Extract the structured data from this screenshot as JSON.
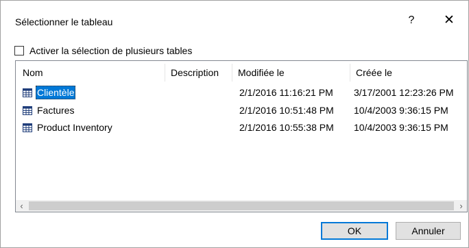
{
  "dialog": {
    "title": "Sélectionner le tableau",
    "help_label": "?",
    "close_label": "✕"
  },
  "multi_select": {
    "label": "Activer la sélection de plusieurs tables",
    "checked": false
  },
  "table_list": {
    "columns": [
      "Nom",
      "Description",
      "Modifiée le",
      "Créée le"
    ],
    "rows": [
      {
        "name": "Clientèle",
        "description": "",
        "modified": "2/1/2016 11:16:21 PM",
        "created": "3/17/2001 12:23:26 PM",
        "selected": true,
        "icon": "table-icon"
      },
      {
        "name": "Factures",
        "description": "",
        "modified": "2/1/2016 10:51:48 PM",
        "created": "10/4/2003 9:36:15 PM",
        "selected": false,
        "icon": "table-icon"
      },
      {
        "name": "Product Inventory",
        "description": "",
        "modified": "2/1/2016 10:55:38 PM",
        "created": "10/4/2003 9:36:15 PM",
        "selected": false,
        "icon": "table-icon"
      }
    ],
    "scroll_left_label": "‹",
    "scroll_right_label": "›"
  },
  "buttons": {
    "ok_label": "OK",
    "cancel_label": "Annuler"
  },
  "colors": {
    "selection": "#0078d7",
    "icon_blue": "#1f3d7a"
  }
}
